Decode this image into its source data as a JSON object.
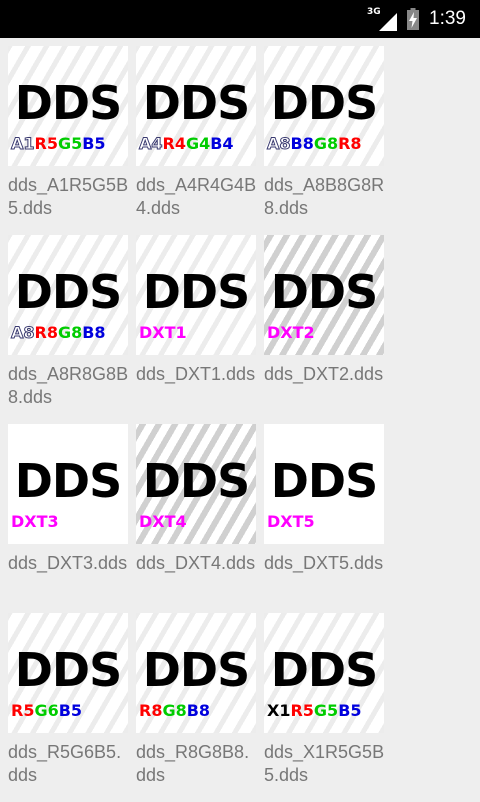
{
  "status_bar": {
    "network": "3G",
    "time": "1:39",
    "icons": [
      "signal-icon",
      "battery-charging-icon"
    ]
  },
  "files": [
    {
      "name": "dds_A1R5G5B5.dds",
      "thumb_title": "DDS",
      "label": [
        {
          "t": "A1",
          "c": "alpha"
        },
        {
          "t": "R5",
          "c": "red"
        },
        {
          "t": "G5",
          "c": "green"
        },
        {
          "t": "B5",
          "c": "blue"
        }
      ],
      "watermark": "light"
    },
    {
      "name": "dds_A4R4G4B4.dds",
      "thumb_title": "DDS",
      "label": [
        {
          "t": "A4",
          "c": "alpha"
        },
        {
          "t": "R4",
          "c": "red"
        },
        {
          "t": "G4",
          "c": "green"
        },
        {
          "t": "B4",
          "c": "blue"
        }
      ],
      "watermark": "light"
    },
    {
      "name": "dds_A8B8G8R8.dds",
      "thumb_title": "DDS",
      "label": [
        {
          "t": "A8",
          "c": "alpha"
        },
        {
          "t": "B8",
          "c": "blue"
        },
        {
          "t": "G8",
          "c": "green"
        },
        {
          "t": "R8",
          "c": "red"
        }
      ],
      "watermark": "light"
    },
    {
      "name": "dds_A8R8G8B8.dds",
      "thumb_title": "DDS",
      "label": [
        {
          "t": "A8",
          "c": "alpha"
        },
        {
          "t": "R8",
          "c": "red"
        },
        {
          "t": "G8",
          "c": "green"
        },
        {
          "t": "B8",
          "c": "blue"
        }
      ],
      "watermark": "light"
    },
    {
      "name": "dds_DXT1.dds",
      "thumb_title": "DDS",
      "label": [
        {
          "t": "DXT1",
          "c": "magenta"
        }
      ],
      "watermark": "light"
    },
    {
      "name": "dds_DXT2.dds",
      "thumb_title": "DDS",
      "label": [
        {
          "t": "DXT2",
          "c": "magenta"
        }
      ],
      "watermark": "strong"
    },
    {
      "name": "dds_DXT3.dds",
      "thumb_title": "DDS",
      "label": [
        {
          "t": "DXT3",
          "c": "magenta"
        }
      ],
      "watermark": "none"
    },
    {
      "name": "dds_DXT4.dds",
      "thumb_title": "DDS",
      "label": [
        {
          "t": "DXT4",
          "c": "magenta"
        }
      ],
      "watermark": "strong"
    },
    {
      "name": "dds_DXT5.dds",
      "thumb_title": "DDS",
      "label": [
        {
          "t": "DXT5",
          "c": "magenta"
        }
      ],
      "watermark": "none"
    },
    {
      "name": "dds_R5G6B5.dds",
      "thumb_title": "DDS",
      "label": [
        {
          "t": "R5",
          "c": "red"
        },
        {
          "t": "G6",
          "c": "green"
        },
        {
          "t": "B5",
          "c": "blue"
        }
      ],
      "watermark": "light"
    },
    {
      "name": "dds_R8G8B8.dds",
      "thumb_title": "DDS",
      "label": [
        {
          "t": "R8",
          "c": "red"
        },
        {
          "t": "G8",
          "c": "green"
        },
        {
          "t": "B8",
          "c": "blue"
        }
      ],
      "watermark": "light"
    },
    {
      "name": "dds_X1R5G5B5.dds",
      "thumb_title": "DDS",
      "label": [
        {
          "t": "X1",
          "c": "black"
        },
        {
          "t": "R5",
          "c": "red"
        },
        {
          "t": "G5",
          "c": "green"
        },
        {
          "t": "B5",
          "c": "blue"
        }
      ],
      "watermark": "light"
    }
  ],
  "colors": {
    "background": "#eeeeee",
    "status_bar": "#000000",
    "caption": "#777777",
    "red": "#ff0000",
    "green": "#00cc00",
    "blue": "#0000dd",
    "magenta": "#ff00ff"
  }
}
